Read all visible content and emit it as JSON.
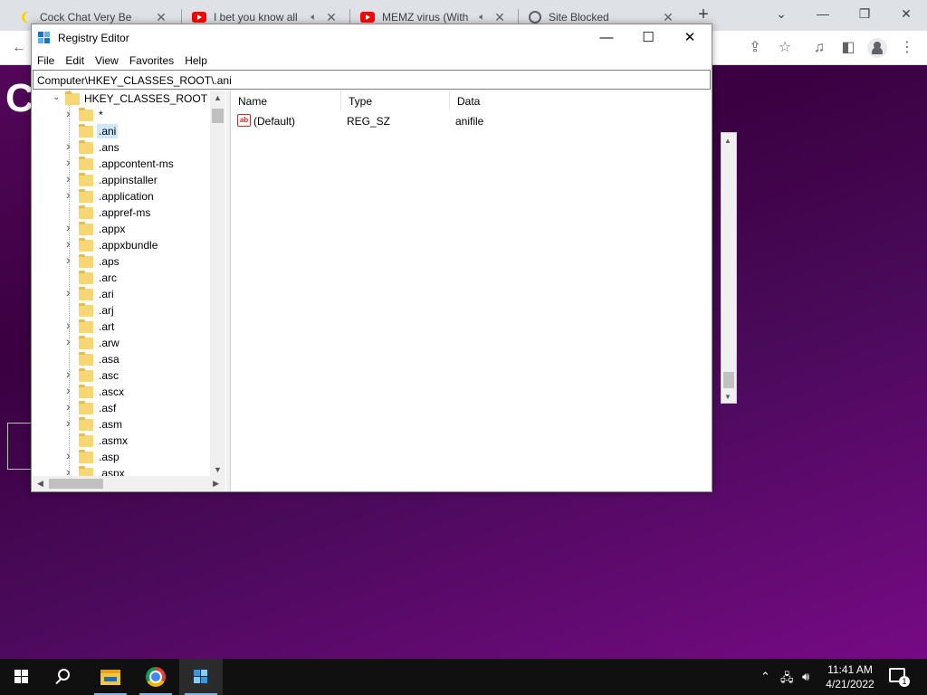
{
  "browser": {
    "tabs": [
      {
        "title": "Cock Chat Very Be",
        "icon": "moon-icon",
        "muted_icon": false
      },
      {
        "title": "I bet you know all",
        "icon": "youtube-icon",
        "muted_icon": true
      },
      {
        "title": "MEMZ virus (With",
        "icon": "youtube-icon",
        "muted_icon": true
      },
      {
        "title": "Site Blocked",
        "icon": "globe-icon",
        "muted_icon": false
      }
    ],
    "new_tab_glyph": "+",
    "page_letter": "C"
  },
  "regedit": {
    "title": "Registry Editor",
    "menu": [
      "File",
      "Edit",
      "View",
      "Favorites",
      "Help"
    ],
    "address": "Computer\\HKEY_CLASSES_ROOT\\.ani",
    "tree_root": "HKEY_CLASSES_ROOT",
    "tree_items": [
      {
        "label": "*",
        "expandable": true
      },
      {
        "label": ".ani",
        "expandable": false,
        "selected": true
      },
      {
        "label": ".ans",
        "expandable": true
      },
      {
        "label": ".appcontent-ms",
        "expandable": true
      },
      {
        "label": ".appinstaller",
        "expandable": true
      },
      {
        "label": ".application",
        "expandable": true
      },
      {
        "label": ".appref-ms",
        "expandable": false
      },
      {
        "label": ".appx",
        "expandable": true
      },
      {
        "label": ".appxbundle",
        "expandable": true
      },
      {
        "label": ".aps",
        "expandable": true
      },
      {
        "label": ".arc",
        "expandable": false
      },
      {
        "label": ".ari",
        "expandable": true
      },
      {
        "label": ".arj",
        "expandable": false
      },
      {
        "label": ".art",
        "expandable": true
      },
      {
        "label": ".arw",
        "expandable": true
      },
      {
        "label": ".asa",
        "expandable": false
      },
      {
        "label": ".asc",
        "expandable": true
      },
      {
        "label": ".ascx",
        "expandable": true
      },
      {
        "label": ".asf",
        "expandable": true
      },
      {
        "label": ".asm",
        "expandable": true
      },
      {
        "label": ".asmx",
        "expandable": false
      },
      {
        "label": ".asp",
        "expandable": true
      },
      {
        "label": ".aspx",
        "expandable": true
      }
    ],
    "columns": {
      "name": "Name",
      "type": "Type",
      "data": "Data"
    },
    "values": [
      {
        "name": "(Default)",
        "type": "REG_SZ",
        "data": "anifile"
      }
    ]
  },
  "taskbar": {
    "time": "11:41 AM",
    "date": "4/21/2022",
    "notification_count": "1"
  }
}
